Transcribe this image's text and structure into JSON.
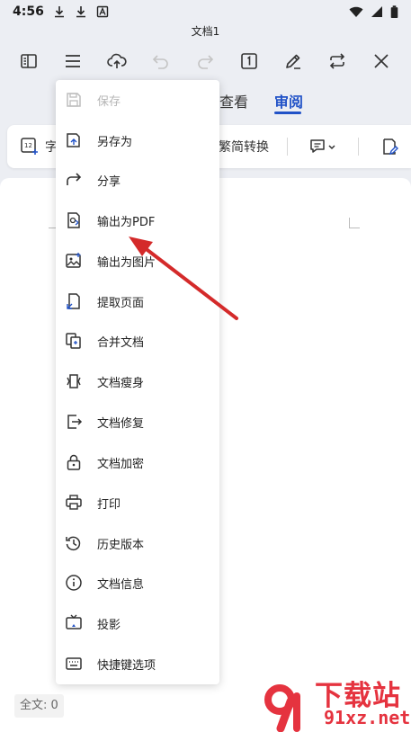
{
  "status_bar": {
    "time": "4:56"
  },
  "document": {
    "title": "文档1",
    "word_count": "全文: 0"
  },
  "tabs": {
    "view": "查看",
    "review": "审阅"
  },
  "ribbon": {
    "item1": "字",
    "item2": "繁简转换"
  },
  "menu": {
    "items": [
      {
        "label": "保存",
        "icon": "save-icon",
        "enabled": false
      },
      {
        "label": "另存为",
        "icon": "save-as-icon",
        "enabled": true
      },
      {
        "label": "分享",
        "icon": "share-icon",
        "enabled": true
      },
      {
        "label": "输出为PDF",
        "icon": "export-pdf-icon",
        "enabled": true
      },
      {
        "label": "输出为图片",
        "icon": "export-image-icon",
        "enabled": true
      },
      {
        "label": "提取页面",
        "icon": "extract-page-icon",
        "enabled": true
      },
      {
        "label": "合并文档",
        "icon": "merge-doc-icon",
        "enabled": true
      },
      {
        "label": "文档瘦身",
        "icon": "slim-doc-icon",
        "enabled": true
      },
      {
        "label": "文档修复",
        "icon": "repair-doc-icon",
        "enabled": true
      },
      {
        "label": "文档加密",
        "icon": "lock-icon",
        "enabled": true
      },
      {
        "label": "打印",
        "icon": "printer-icon",
        "enabled": true
      },
      {
        "label": "历史版本",
        "icon": "history-icon",
        "enabled": true
      },
      {
        "label": "文档信息",
        "icon": "info-icon",
        "enabled": true
      },
      {
        "label": "投影",
        "icon": "projection-icon",
        "enabled": true
      },
      {
        "label": "快捷键选项",
        "icon": "keyboard-icon",
        "enabled": true
      }
    ]
  },
  "watermark": {
    "brand": "下载站",
    "domain": "91xz.net"
  },
  "colors": {
    "accent": "#2152c7",
    "annotation": "#d42a2a",
    "watermark": "#e5333f"
  }
}
